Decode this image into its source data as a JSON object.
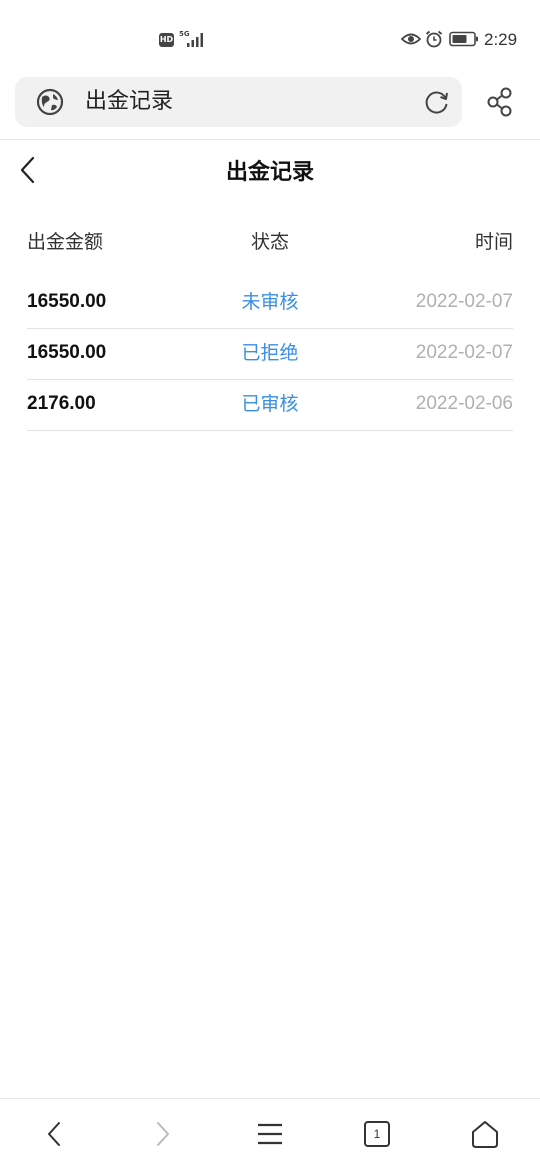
{
  "status_bar": {
    "hd_badge": "HD",
    "network": "5G",
    "time": "2:29",
    "icons": [
      "signal-icon",
      "eye-icon",
      "alarm-icon",
      "battery-icon"
    ]
  },
  "browser": {
    "address_text": "出金记录",
    "icons": [
      "globe-icon",
      "reload-icon",
      "share-icon"
    ]
  },
  "page": {
    "title": "出金记录",
    "back_icon": "chevron-left-icon"
  },
  "table": {
    "headers": {
      "amount": "出金金额",
      "status": "状态",
      "time": "时间"
    },
    "rows": [
      {
        "amount": "16550.00",
        "status": "未审核",
        "time": "2022-02-07"
      },
      {
        "amount": "16550.00",
        "status": "已拒绝",
        "time": "2022-02-07"
      },
      {
        "amount": "2176.00",
        "status": "已审核",
        "time": "2022-02-06"
      }
    ]
  },
  "bottom_nav": {
    "tab_count": "1",
    "icons": [
      "back-icon",
      "forward-icon",
      "menu-icon",
      "tabs-icon",
      "home-icon"
    ]
  },
  "colors": {
    "status_text": "#3a8ee6",
    "time_text": "#b0b0b0",
    "address_bar_bg": "#f1f1f1"
  }
}
